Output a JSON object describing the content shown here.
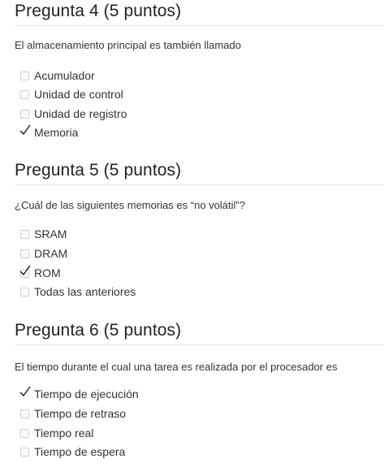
{
  "questions": [
    {
      "title": "Pregunta 4 (5 puntos)",
      "text": "El almacenamiento principal es también llamado",
      "options": [
        {
          "label": "Acumulador",
          "checked": false
        },
        {
          "label": "Unidad de control",
          "checked": false
        },
        {
          "label": "Unidad de registro",
          "checked": false
        },
        {
          "label": "Memoria",
          "checked": true
        }
      ]
    },
    {
      "title": "Pregunta 5 (5 puntos)",
      "text": "¿Cuál de las siguientes memorias es “no volátil”?",
      "options": [
        {
          "label": "SRAM",
          "checked": false
        },
        {
          "label": "DRAM",
          "checked": false
        },
        {
          "label": "ROM",
          "checked": true
        },
        {
          "label": "Todas las anteriores",
          "checked": false
        }
      ]
    },
    {
      "title": "Pregunta 6 (5 puntos)",
      "text": "El tiempo durante el cual una tarea es realizada por el procesador es",
      "options": [
        {
          "label": "Tiempo de ejecución",
          "checked": true
        },
        {
          "label": "Tiempo de retraso",
          "checked": false
        },
        {
          "label": "Tiempo real",
          "checked": false
        },
        {
          "label": "Tiempo de espera",
          "checked": false
        }
      ]
    }
  ]
}
